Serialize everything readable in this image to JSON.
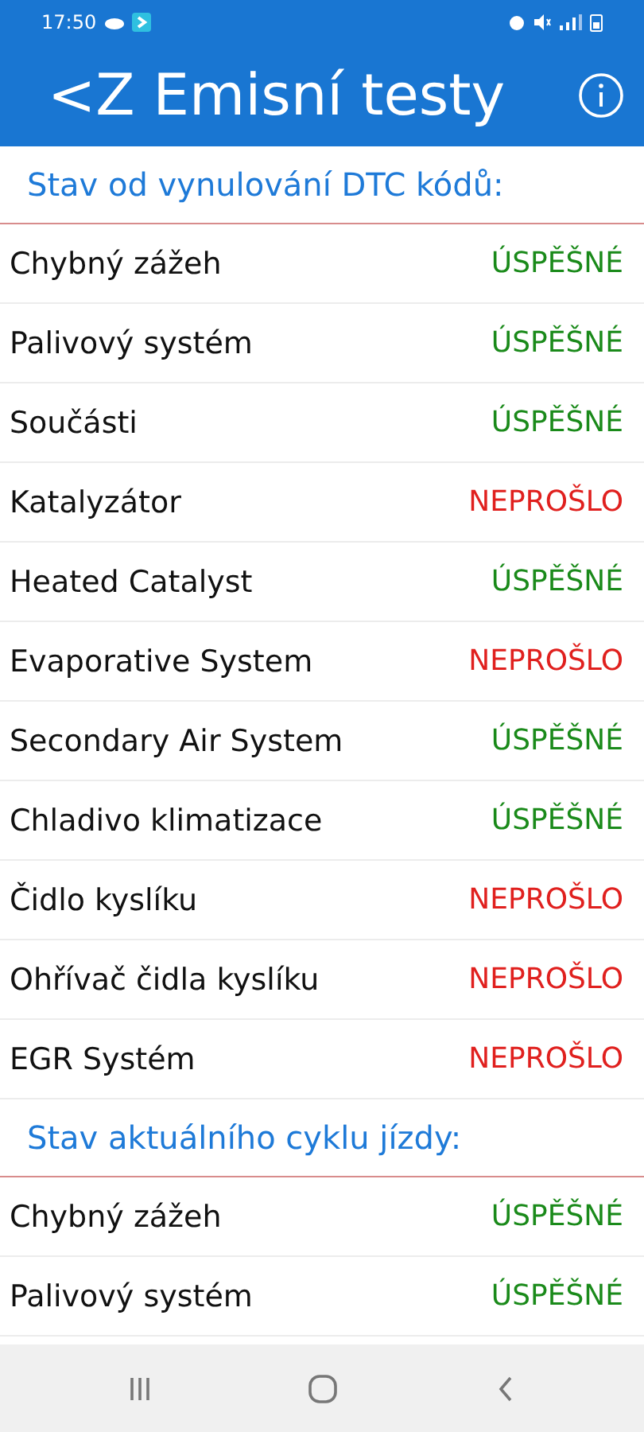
{
  "status_bar": {
    "time": "17:50"
  },
  "header": {
    "title": "<Z Emisní testy"
  },
  "sections": [
    {
      "title": "Stav od vynulování DTC kódů:",
      "rows": [
        {
          "name": "Chybný zážeh",
          "result": "ÚSPĚŠNÉ",
          "kind": "pass"
        },
        {
          "name": "Palivový systém",
          "result": "ÚSPĚŠNÉ",
          "kind": "pass"
        },
        {
          "name": "Součásti",
          "result": "ÚSPĚŠNÉ",
          "kind": "pass"
        },
        {
          "name": "Katalyzátor",
          "result": "NEPROŠLO",
          "kind": "fail"
        },
        {
          "name": "Heated Catalyst",
          "result": "ÚSPĚŠNÉ",
          "kind": "pass"
        },
        {
          "name": "Evaporative System",
          "result": "NEPROŠLO",
          "kind": "fail"
        },
        {
          "name": "Secondary Air System",
          "result": "ÚSPĚŠNÉ",
          "kind": "pass"
        },
        {
          "name": "Chladivo klimatizace",
          "result": "ÚSPĚŠNÉ",
          "kind": "pass"
        },
        {
          "name": "Čidlo kyslíku",
          "result": "NEPROŠLO",
          "kind": "fail"
        },
        {
          "name": "Ohřívač čidla kyslíku",
          "result": "NEPROŠLO",
          "kind": "fail"
        },
        {
          "name": "EGR Systém",
          "result": "NEPROŠLO",
          "kind": "fail"
        }
      ]
    },
    {
      "title": "Stav aktuálního cyklu jízdy:",
      "rows": [
        {
          "name": "Chybný zážeh",
          "result": "ÚSPĚŠNÉ",
          "kind": "pass"
        },
        {
          "name": "Palivový systém",
          "result": "ÚSPĚŠNÉ",
          "kind": "pass"
        }
      ]
    }
  ]
}
